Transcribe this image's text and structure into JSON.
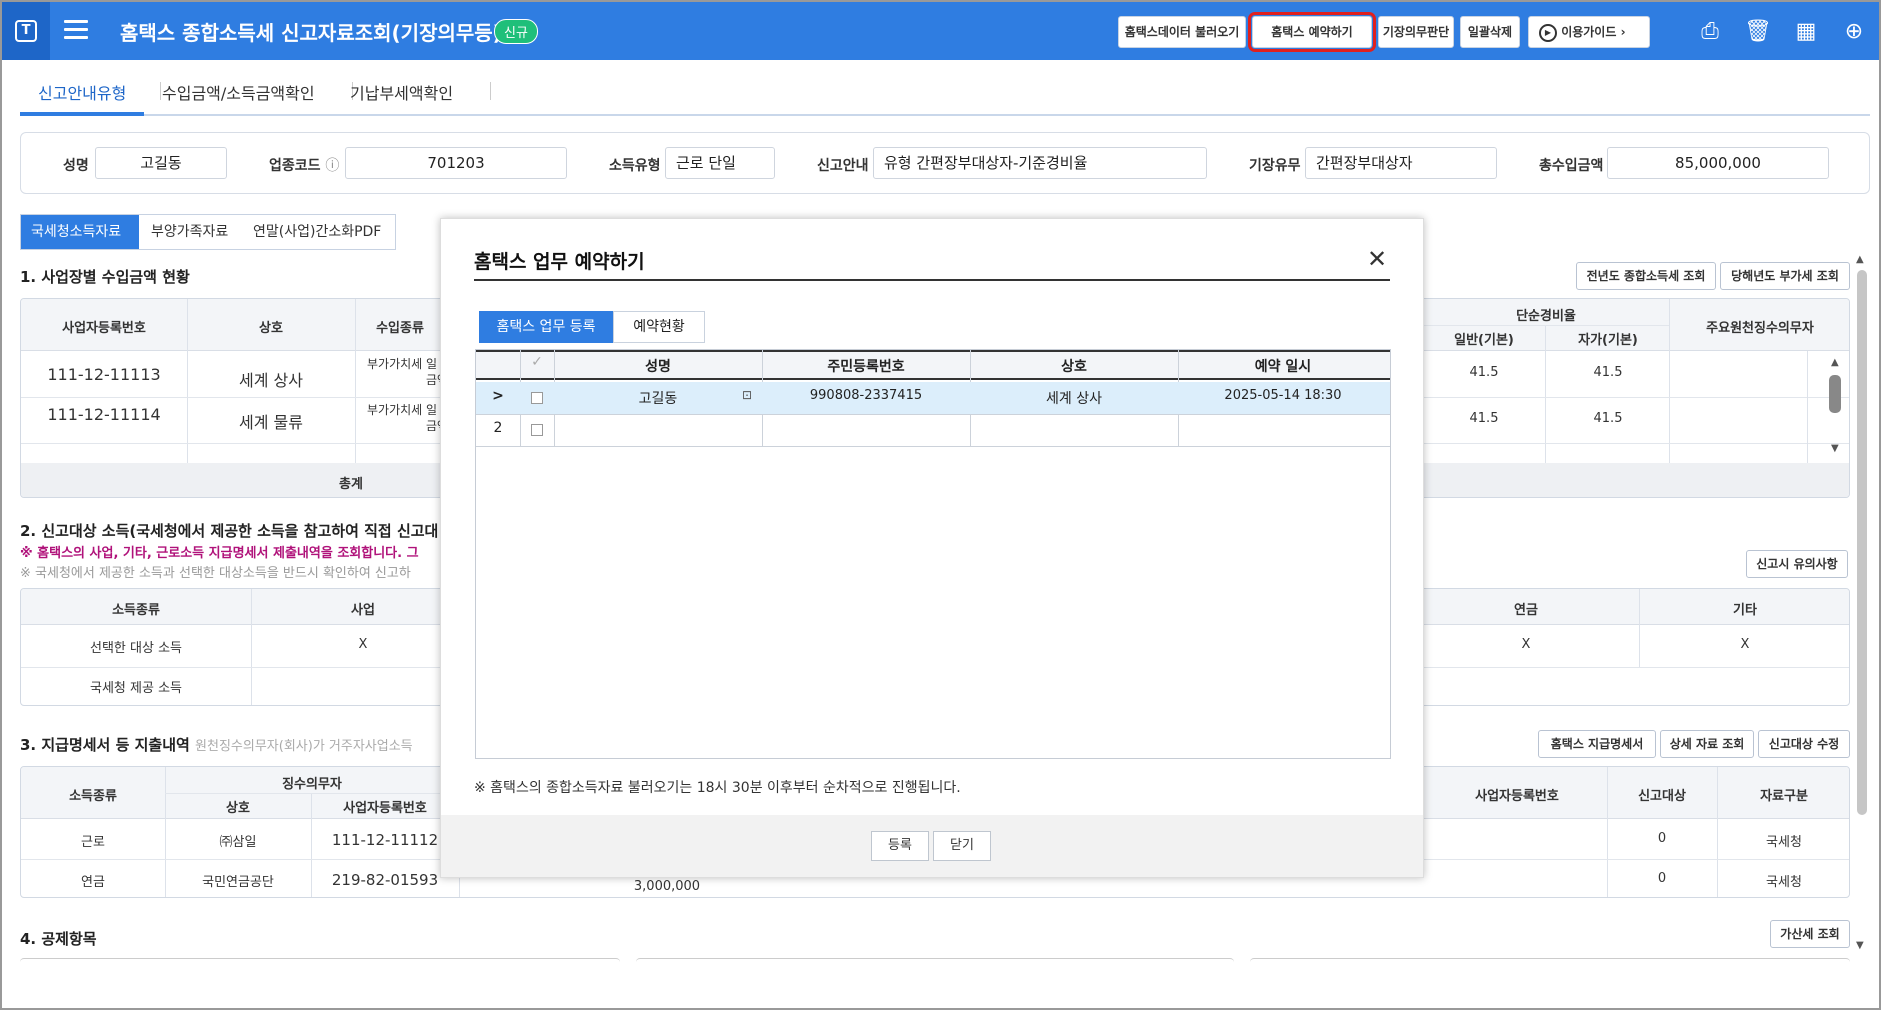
{
  "app": {
    "title": "홈택스 종합소득세 신고자료조회(기장의무등)",
    "badge": "신규",
    "logo": "T"
  },
  "toolbar": {
    "buttons": [
      "홈택스데이터 불러오기",
      "홈택스 예약하기",
      "기장의무판단",
      "일괄삭제",
      "이용가이드"
    ],
    "icons": [
      "printer-icon",
      "trash-icon",
      "excel-icon",
      "more-icon"
    ]
  },
  "main_tabs": [
    "신고안내유형",
    "수입금액/소득금액확인",
    "기납부세액확인"
  ],
  "info": {
    "name_label": "성명",
    "name_value": "고길동",
    "biz_code_label": "업종코드",
    "biz_code_value": "701203",
    "income_type_label": "소득유형",
    "income_type_value": "근로 단일",
    "guide_label": "신고안내",
    "guide_value": "유형 간편장부대상자-기준경비율",
    "bookkeeping_label": "기장유무",
    "bookkeeping_value": "간편장부대상자",
    "total_income_label": "총수입금액",
    "total_income_value": "85,000,000"
  },
  "sub_tabs": [
    "국세청소득자료",
    "부양가족자료",
    "연말(사업)간소화PDF"
  ],
  "section1": {
    "title": "1. 사업장별 수입금액 현황",
    "buttons": [
      "전년도 종합소득세 조회",
      "당해년도 부가세 조회"
    ],
    "headers": [
      "사업자등록번호",
      "상호",
      "수입종류",
      "단순경비율",
      "일반(기본)",
      "자가(기본)",
      "주요원천징수의무자"
    ],
    "rows": [
      {
        "reg": "111-12-11113",
        "name": "세계 상사",
        "type": "부가가치세 일",
        "type2": "금액",
        "general": "41.5",
        "self": "41.5"
      },
      {
        "reg": "111-12-11114",
        "name": "세계 물류",
        "type": "부가가치세 일",
        "type2": "금액",
        "general": "41.5",
        "self": "41.5"
      }
    ],
    "total_label": "총계"
  },
  "section2": {
    "title": "2. 신고대상 소득(국세청에서 제공한 소득을 참고하여 직접 신고대",
    "note_red": "※ 홈택스의 사업, 기타, 근로소득 지급명세서 제출내역을 조회합니다. 그",
    "note_grey": "※ 국세청에서 제공한 소득과 선택한 대상소득을 반드시 확인하여 신고하",
    "button": "신고시 유의사항",
    "headers": [
      "소득종류",
      "사업",
      "연금",
      "기타"
    ],
    "rows": [
      {
        "label": "선택한 대상 소득",
        "biz": "X",
        "pension": "X",
        "etc": "X"
      },
      {
        "label": "국세청 제공 소득"
      }
    ]
  },
  "section3": {
    "title": "3. 지급명세서 등 지출내역",
    "subtitle": "원천징수의무자(회사)가 거주자사업소득",
    "buttons": [
      "홈택스 지급명세서",
      "상세 자료 조회",
      "신고대상 수정"
    ],
    "headers": [
      "소득종류",
      "징수의무자",
      "상호",
      "사업자등록번호",
      "사업자등록번호",
      "신고대상",
      "자료구분"
    ],
    "rows": [
      {
        "kind": "근로",
        "name": "㈜삼일",
        "reg": "111-12-11112",
        "target": "0",
        "src": "국세청"
      },
      {
        "kind": "연금",
        "name": "국민연금공단",
        "reg": "219-82-01593",
        "amount": "3,000,000",
        "target": "0",
        "src": "국세청"
      }
    ]
  },
  "section4": {
    "title": "4. 공제항목",
    "button": "가산세 조회"
  },
  "modal": {
    "title": "홈택스 업무 예약하기",
    "tabs": [
      "홈택스 업무 등록",
      "예약현황"
    ],
    "headers": [
      "성명",
      "주민등록번호",
      "상호",
      "예약 일시"
    ],
    "rows": [
      {
        "no": ">",
        "name": "고길동",
        "rrn": "990808-2337415",
        "company": "세계 상사",
        "datetime": "2025-05-14 18:30"
      },
      {
        "no": "2",
        "name": "",
        "rrn": "",
        "company": "",
        "datetime": ""
      }
    ],
    "note": "※ 홈택스의 종합소득자료 불러오기는 18시 30분 이후부터 순차적으로 진행됩니다.",
    "register_label": "등록",
    "close_label": "닫기"
  }
}
